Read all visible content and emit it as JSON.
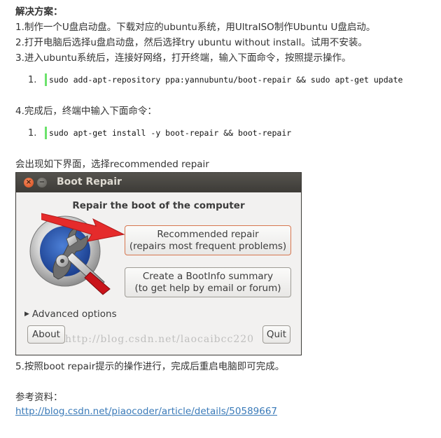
{
  "doc": {
    "heading": "解决方案：",
    "step1": "1.制作一个U盘启动盘。下载对应的ubuntu系统，用UltraISO制作Ubuntu U盘启动。",
    "step2": "2.打开电脑后选择u盘启动盘，然后选择try ubuntu without install。试用不安装。",
    "step3": "3.进入ubuntu系统后，连接好网络，打开终端，输入下面命令，按照提示操作。",
    "code1_num": "1.",
    "code1": "sudo add-apt-repository ppa:yannubuntu/boot-repair && sudo apt-get update",
    "step4": "4.完成后，终端中输入下面命令：",
    "code2_num": "1.",
    "code2": "sudo apt-get install -y boot-repair && boot-repair",
    "caption": "会出现如下界面，选择recommended repair",
    "step5": "5.按照boot repair提示的操作进行，完成后重启电脑即可完成。",
    "ref_label": "参考资料：",
    "ref_link": "http://blog.csdn.net/piaocoder/article/details/50589667"
  },
  "window": {
    "title": "Boot Repair",
    "close_glyph": "×",
    "min_glyph": "−",
    "heading": "Repair the boot of the computer",
    "recommended_line1": "Recommended repair",
    "recommended_line2": "(repairs most frequent problems)",
    "bootinfo_line1": "Create a BootInfo summary",
    "bootinfo_line2": "(to get help by email or forum)",
    "advanced_arrow": "▶",
    "advanced": "Advanced options",
    "about": "About",
    "quit": "Quit",
    "watermark": "http://blog.csdn.net/laocaibcc220"
  },
  "colors": {
    "link": "#3a7ab8",
    "code_bar": "#6ce26c",
    "arrow": "#e52b2b"
  }
}
